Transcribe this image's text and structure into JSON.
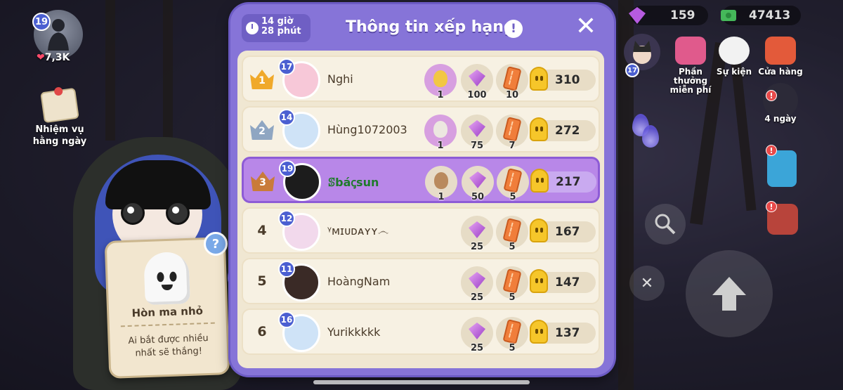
{
  "player_hud": {
    "level": "19",
    "likes": "7,3K",
    "daily_task_label": "Nhiệm vụ hằng ngày"
  },
  "ghost_card": {
    "title": "Hòn ma nhỏ",
    "description": "Ai bắt được nhiều nhất sẽ thắng!",
    "help": "?"
  },
  "currencies": {
    "gems": "159",
    "cash": "47413"
  },
  "menu": {
    "free_reward": "Phần thưởng miễn phí",
    "events": "Sự kiện",
    "shop": "Cửa hàng",
    "days_left": "4 ngày",
    "avatar_level": "17"
  },
  "panel": {
    "timer": "14 giờ 28 phút",
    "title": "Thông tin xếp hạng",
    "info": "!",
    "close": "✕"
  },
  "leaderboard": [
    {
      "rank": "1",
      "level": "17",
      "name": "Nghi",
      "egg": "1",
      "gems": "100",
      "coupons": "10",
      "score": "310",
      "egg_color": "#f2c744"
    },
    {
      "rank": "2",
      "level": "14",
      "name": "Hùng1072003",
      "egg": "1",
      "gems": "75",
      "coupons": "7",
      "score": "272",
      "egg_color": "#ece7e0"
    },
    {
      "rank": "3",
      "level": "19",
      "name": "ꕷbáꞔsun",
      "egg": "1",
      "gems": "50",
      "coupons": "5",
      "score": "217",
      "egg_color": "#b98a5e"
    },
    {
      "rank": "4",
      "level": "12",
      "name": "ᵞᴍɪᴜᴅᴀʏʏ෴",
      "gems": "25",
      "coupons": "5",
      "score": "167"
    },
    {
      "rank": "5",
      "level": "11",
      "name": "HoàngNam",
      "gems": "25",
      "coupons": "5",
      "score": "147"
    },
    {
      "rank": "6",
      "level": "16",
      "name": "Yurikkkkk",
      "gems": "25",
      "coupons": "5",
      "score": "137"
    }
  ],
  "colors": {
    "panel": "#8674d8",
    "gold": "#f0a92a",
    "silver": "#8fa6c2",
    "bronze": "#c97b3a",
    "highlight": "#b887e8"
  }
}
